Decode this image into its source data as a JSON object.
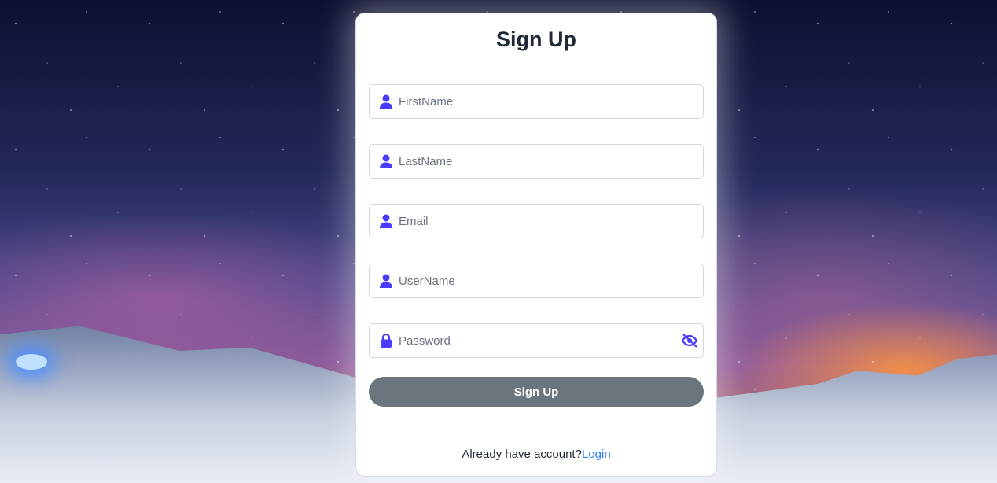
{
  "title": "Sign Up",
  "fields": [
    {
      "placeholder": "FirstName",
      "icon": "user-icon"
    },
    {
      "placeholder": "LastName",
      "icon": "user-icon"
    },
    {
      "placeholder": "Email",
      "icon": "user-icon"
    },
    {
      "placeholder": "UserName",
      "icon": "user-icon"
    },
    {
      "placeholder": "Password",
      "icon": "lock-icon"
    }
  ],
  "submit_label": "Sign Up",
  "footer": {
    "text": "Already have account?",
    "link": "Login"
  },
  "colors": {
    "icon": "#4a3cff",
    "button": "#6c757d",
    "link": "#2a7fff"
  }
}
